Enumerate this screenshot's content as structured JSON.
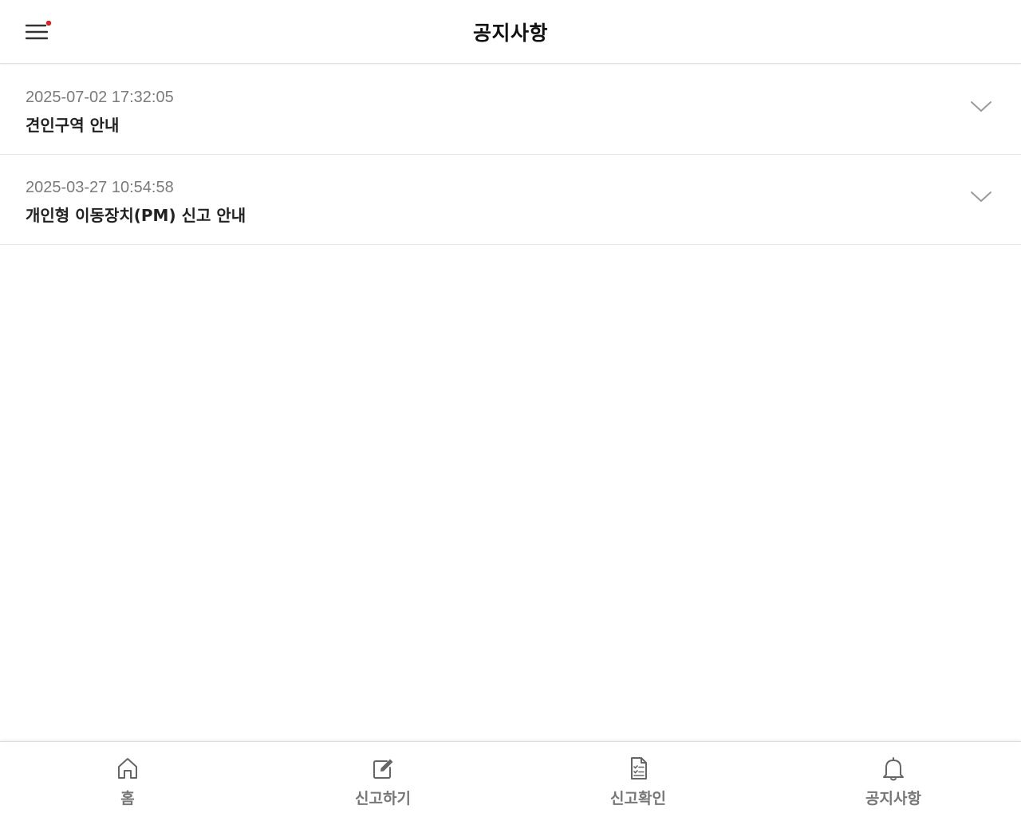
{
  "header": {
    "title": "공지사항",
    "menu_icon": "hamburger-menu-icon",
    "notification_dot_color": "#e02020"
  },
  "notices": [
    {
      "date": "2025-07-02 17:32:05",
      "title": "견인구역 안내"
    },
    {
      "date": "2025-03-27 10:54:58",
      "title": "개인형 이동장치(PM) 신고 안내"
    }
  ],
  "bottom_nav": {
    "items": [
      {
        "label": "홈",
        "icon": "home-icon"
      },
      {
        "label": "신고하기",
        "icon": "edit-icon"
      },
      {
        "label": "신고확인",
        "icon": "document-check-icon"
      },
      {
        "label": "공지사항",
        "icon": "bell-icon"
      }
    ]
  },
  "colors": {
    "accent_dot": "#e02020",
    "icon_gray": "#666666",
    "label_gray": "#777777",
    "date_gray": "#7b7b7b"
  }
}
